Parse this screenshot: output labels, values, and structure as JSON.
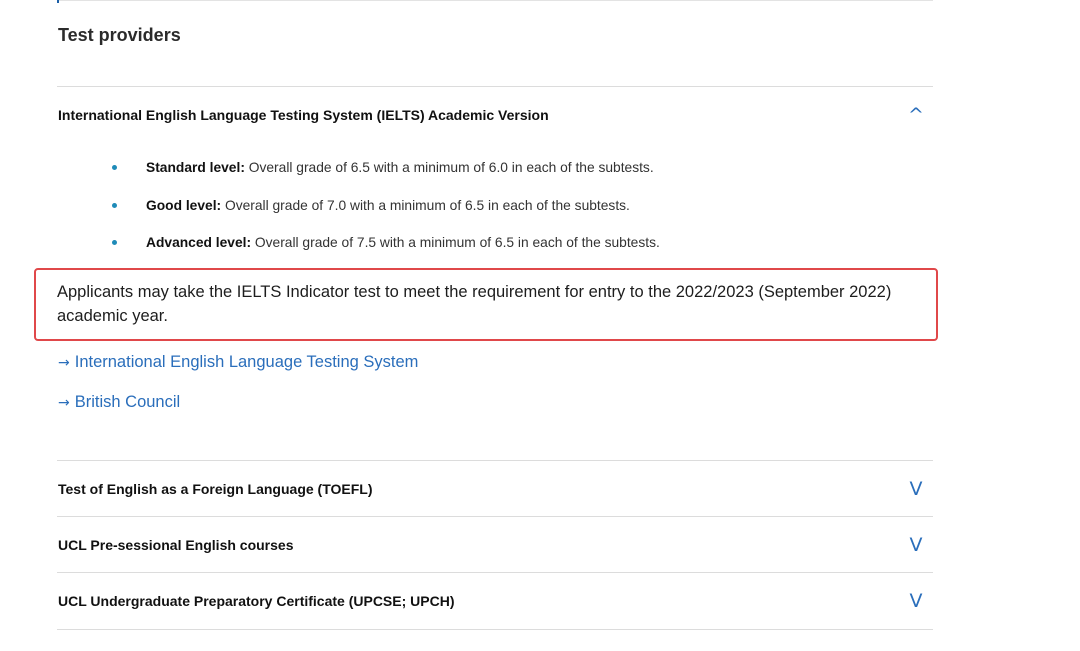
{
  "section": {
    "title": "Test providers"
  },
  "accordions": [
    {
      "title": "International English Language Testing System (IELTS) Academic Version",
      "chevron": "^",
      "expanded": true,
      "bullets": [
        {
          "label": "Standard level:",
          "text": " Overall grade of 6.5 with a minimum of 6.0 in each of the subtests."
        },
        {
          "label": "Good level:",
          "text": " Overall grade of 7.0 with a minimum of 6.5 in each of the subtests."
        },
        {
          "label": "Advanced level:",
          "text": " Overall grade of 7.5 with a minimum of 6.5 in each of the subtests."
        }
      ],
      "note": "Applicants may take the IELTS Indicator test to meet the requirement for entry to the 2022/2023 (September 2022) academic year.",
      "links": [
        {
          "arrow": "→",
          "label": "International English Language Testing System"
        },
        {
          "arrow": "→",
          "label": "British Council"
        }
      ]
    },
    {
      "title": "Test of English as a Foreign Language (TOEFL)",
      "chevron": "V",
      "expanded": false
    },
    {
      "title": "UCL Pre-sessional English courses",
      "chevron": "V",
      "expanded": false
    },
    {
      "title": "UCL Undergraduate Preparatory Certificate (UPCSE; UPCH)",
      "chevron": "V",
      "expanded": false
    }
  ],
  "colors": {
    "link": "#2a6ebb",
    "bullet": "#1f8bb8",
    "highlight_border": "#e0484a",
    "divider": "#dcdcdc"
  },
  "icons": {
    "collapse": "chevron-up-icon",
    "expand": "chevron-down-icon",
    "link": "arrow-right-icon"
  }
}
